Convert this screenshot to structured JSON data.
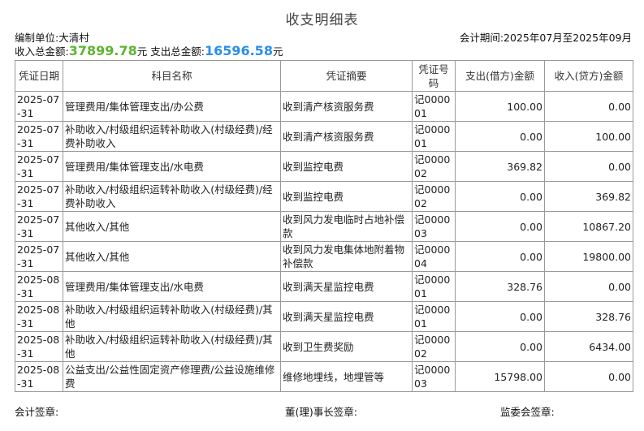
{
  "title": "收支明细表",
  "unit_label": "编制单位:大清村",
  "period_label": "会计期间:2025年07月至2025年09月",
  "totals": {
    "income_label": "收入总金额:",
    "income_value": "37899.78",
    "income_unit": "元",
    "expense_label": " 支出总金额:",
    "expense_value": "16596.58",
    "expense_unit": "元"
  },
  "colors": {
    "income": "#5cb531",
    "expense": "#2a8ee8"
  },
  "table": {
    "headers": [
      "凭证日期",
      "科目名称",
      "凭证摘要",
      "凭证号码",
      "支出(借方)金额",
      "收入(贷方)金额"
    ],
    "rows": [
      [
        "2025-07-31",
        "管理费用/集体管理支出/办公费",
        "收到清产核资服务费",
        "记000001",
        "100.00",
        "0.00"
      ],
      [
        "2025-07-31",
        "补助收入/村级组织运转补助收入(村级经费)/经费补助收入",
        "收到清产核资服务费",
        "记000001",
        "0.00",
        "100.00"
      ],
      [
        "2025-07-31",
        "管理费用/集体管理支出/水电费",
        "收到监控电费",
        "记000002",
        "369.82",
        "0.00"
      ],
      [
        "2025-07-31",
        "补助收入/村级组织运转补助收入(村级经费)/经费补助收入",
        "收到监控电费",
        "记000002",
        "0.00",
        "369.82"
      ],
      [
        "2025-07-31",
        "其他收入/其他",
        "收到风力发电临时占地补偿款",
        "记000003",
        "0.00",
        "10867.20"
      ],
      [
        "2025-07-31",
        "其他收入/其他",
        "收到风力发电集体地附着物补偿款",
        "记000004",
        "0.00",
        "19800.00"
      ],
      [
        "2025-08-31",
        "管理费用/集体管理支出/水电费",
        "收到满天星监控电费",
        "记000001",
        "328.76",
        "0.00"
      ],
      [
        "2025-08-31",
        "补助收入/村级组织运转补助收入(村级经费)/其他",
        "收到满天星监控电费",
        "记000001",
        "0.00",
        "328.76"
      ],
      [
        "2025-08-31",
        "补助收入/村级组织运转补助收入(村级经费)/其他",
        "收到卫生费奖励",
        "记000002",
        "0.00",
        "6434.00"
      ],
      [
        "2025-08-31",
        "公益支出/公益性固定资产修理费/公益设施维修费",
        "维修地埋线，地埋管等",
        "记000003",
        "15798.00",
        "0.00"
      ]
    ]
  },
  "footer": {
    "accountant": "会计签章:",
    "director": "董(理)事长签章:",
    "supervisor": "监委会签章:"
  }
}
